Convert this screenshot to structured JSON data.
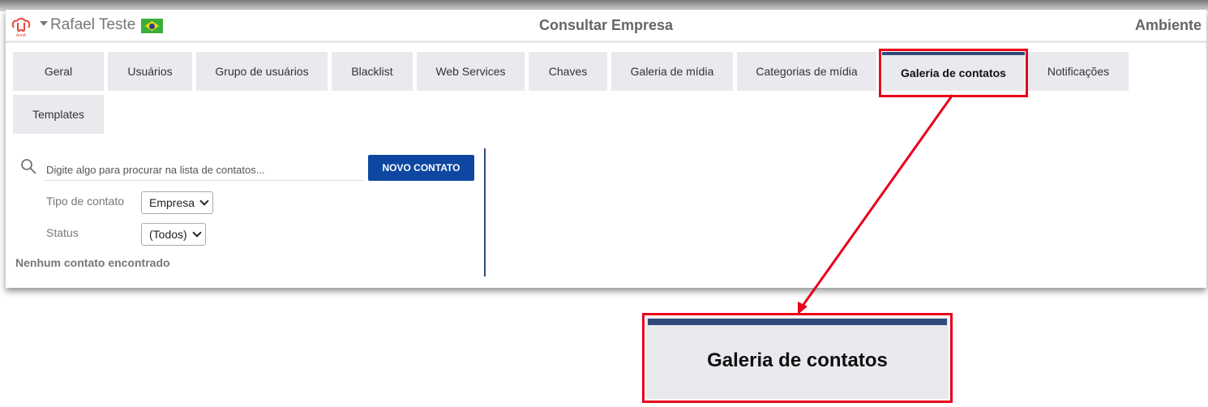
{
  "header": {
    "user": "Rafael Teste",
    "title": "Consultar Empresa",
    "environment": "Ambiente",
    "logo_text": "AnnA"
  },
  "tabs": [
    {
      "label": "Geral"
    },
    {
      "label": "Usuários"
    },
    {
      "label": "Grupo de usuários"
    },
    {
      "label": "Blacklist"
    },
    {
      "label": "Web Services"
    },
    {
      "label": "Chaves"
    },
    {
      "label": "Galeria de mídia"
    },
    {
      "label": "Categorias de mídia"
    },
    {
      "label": "Galeria de contatos",
      "active": true
    },
    {
      "label": "Notificações"
    },
    {
      "label": "Templates"
    }
  ],
  "contacts": {
    "search_placeholder": "Digite algo para procurar na lista de contatos...",
    "new_button": "NOVO CONTATO",
    "type_label": "Tipo de contato",
    "type_value": "Empresa",
    "status_label": "Status",
    "status_value": "(Todos)",
    "empty_message": "Nenhum contato encontrado"
  },
  "callout": {
    "label": "Galeria de contatos"
  },
  "colors": {
    "accent": "#0d47a1",
    "highlight": "#e8001a",
    "tab_indicator": "#2f4a7a"
  }
}
